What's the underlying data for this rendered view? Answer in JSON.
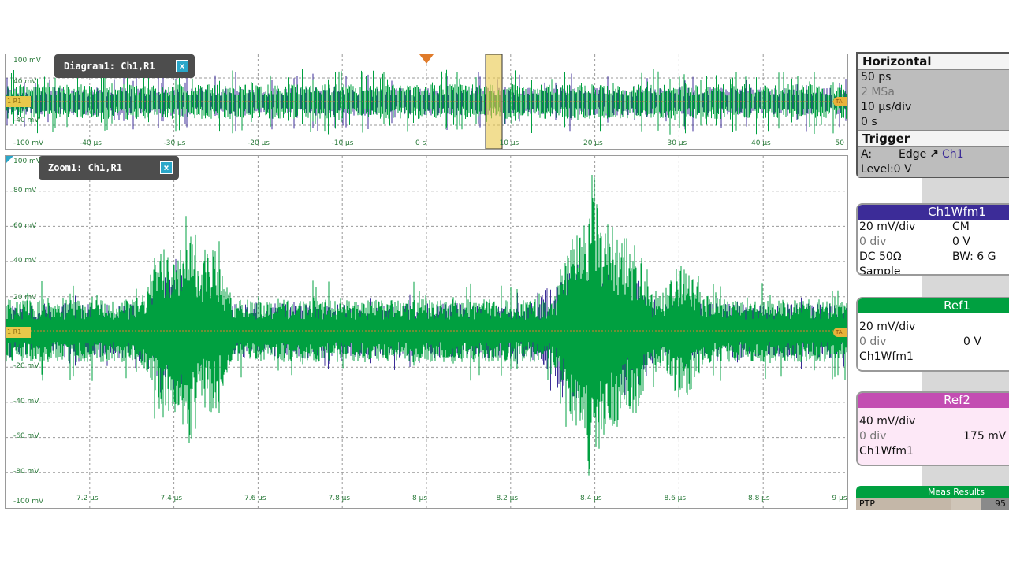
{
  "diagram1": {
    "tab_label": "Diagram1: Ch1,R1",
    "y_labels": [
      "100 mV",
      "40 mV",
      "-40 mV",
      "-100 mV"
    ],
    "x_labels": [
      "-40 µs",
      "-30 µs",
      "-20 µs",
      "-10 µs",
      "0 s",
      "10 µs",
      "20 µs",
      "30 µs",
      "40 µs",
      "50 µs"
    ],
    "left_marker": "1 R1",
    "right_marker": "TA"
  },
  "zoom1": {
    "tab_label": "Zoom1: Ch1,R1",
    "y_labels": [
      "100 mV",
      "80 mV",
      "60 mV",
      "40 mV",
      "20 mV",
      "-20 mV",
      "-40 mV",
      "-60 mV",
      "-80 mV",
      "-100 mV"
    ],
    "x_labels": [
      "7.2 µs",
      "7.4 µs",
      "7.6 µs",
      "7.8 µs",
      "8 µs",
      "8.2 µs",
      "8.4 µs",
      "8.6 µs",
      "8.8 µs",
      "9 µs"
    ],
    "left_marker": "1 R1",
    "right_marker": "TA"
  },
  "horizontal": {
    "title": "Horizontal",
    "resolution": "50 ps",
    "sample_rate": "2 MSa",
    "time_scale": "10 µs/div",
    "position": "0 s"
  },
  "trigger": {
    "title": "Trigger",
    "source_prefix": "A:",
    "type": "Edge",
    "channel": "Ch1",
    "level": "Level:0 V"
  },
  "ch1wfm1": {
    "title": "Ch1Wfm1",
    "scale": "20 mV/div",
    "coupling_mode": "CM",
    "offset_div": "0 div",
    "offset_v": "0 V",
    "coupling": "DC 50Ω",
    "bandwidth": "BW: 6 G",
    "acq_mode": "Sample"
  },
  "ref1": {
    "title": "Ref1",
    "scale": "20 mV/div",
    "offset_div": "0 div",
    "offset_v": "0 V",
    "source": "Ch1Wfm1"
  },
  "ref2": {
    "title": "Ref2",
    "scale": "40 mV/div",
    "offset_div": "0 div",
    "offset_v": "175 mV",
    "source": "Ch1Wfm1"
  },
  "meas": {
    "title": "Meas Results",
    "name": "PTP",
    "value": "95"
  },
  "colors": {
    "ch1": "#3c2c98",
    "ref1": "#00a040",
    "ref2": "#c34db2",
    "grid": "#9a9a9a",
    "zoom_box": "#e9c84a"
  }
}
